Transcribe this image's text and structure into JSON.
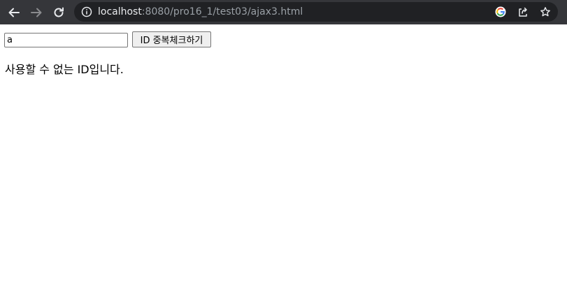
{
  "browser": {
    "url_host": "localhost",
    "url_rest": ":8080/pro16_1/test03/ajax3.html",
    "icons": {
      "back": "arrow-left-icon",
      "forward": "arrow-right-icon",
      "reload": "reload-icon",
      "info": "info-icon",
      "google": "google-icon",
      "share": "share-icon",
      "bookmark": "star-icon"
    }
  },
  "page": {
    "id_input_value": "a",
    "check_button_label": "ID 중복체크하기",
    "message": "사용할 수 없는 ID입니다."
  }
}
